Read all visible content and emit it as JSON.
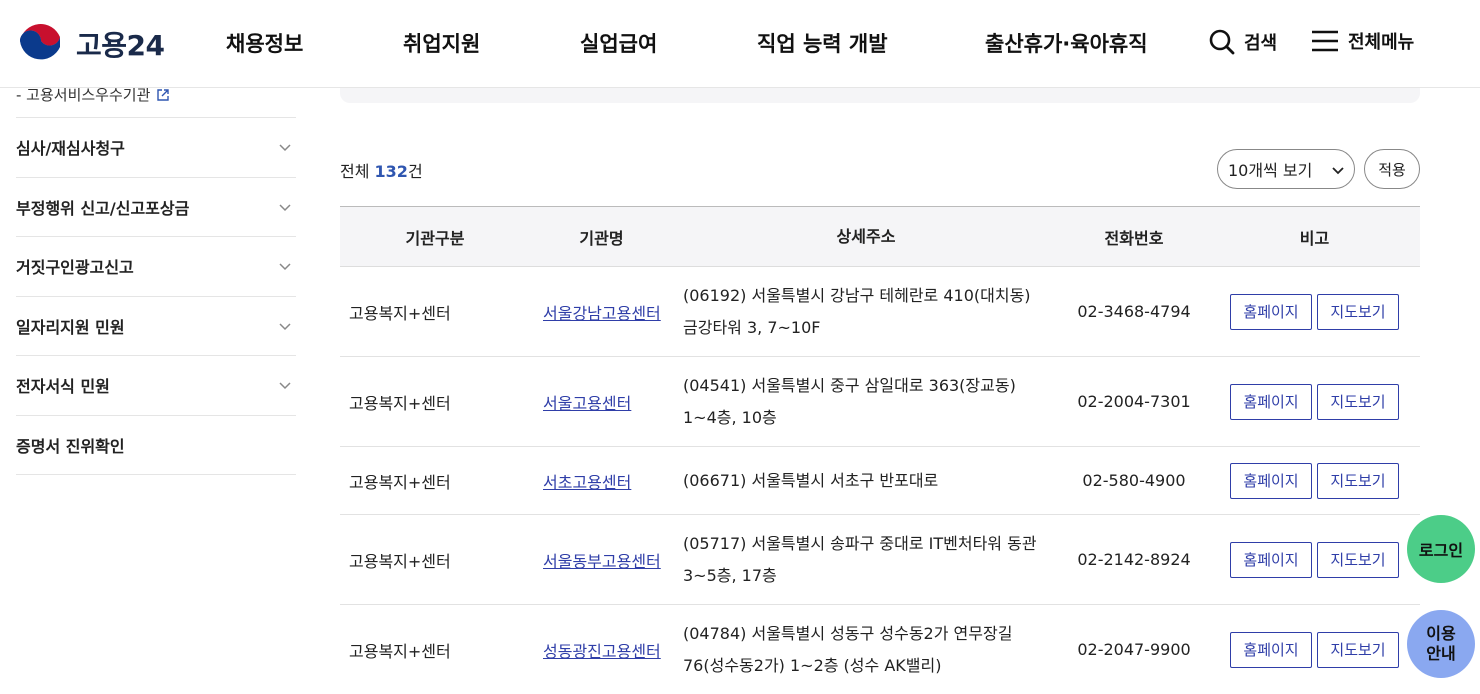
{
  "header": {
    "logo_text": "고용24",
    "nav": [
      "채용정보",
      "취업지원",
      "실업급여",
      "직업 능력 개발",
      "출산휴가·육아휴직"
    ],
    "search_label": "검색",
    "menu_label": "전체메뉴"
  },
  "sidebar": {
    "sub_item": "- 고용서비스우수기관",
    "items": [
      "심사/재심사청구",
      "부정행위 신고/신고포상금",
      "거짓구인광고신고",
      "일자리지원 민원",
      "전자서식 민원",
      "증명서 진위확인"
    ]
  },
  "main": {
    "total_prefix": "전체 ",
    "total_count": "132",
    "total_suffix": "건",
    "select_value": "10개씩 보기",
    "apply_label": "적용",
    "columns": [
      "기관구분",
      "기관명",
      "상세주소",
      "전화번호",
      "비고"
    ],
    "homepage_label": "홈페이지",
    "map_label": "지도보기",
    "rows": [
      {
        "type": "고용복지+센터",
        "name": "서울강남고용센터",
        "address": "(06192) 서울특별시 강남구 테헤란로 410(대치동) 금강타워 3, 7~10F",
        "phone": "02-3468-4794"
      },
      {
        "type": "고용복지+센터",
        "name": "서울고용센터",
        "address": "(04541) 서울특별시 중구 삼일대로 363(장교동) 1~4층, 10층",
        "phone": "02-2004-7301"
      },
      {
        "type": "고용복지+센터",
        "name": "서초고용센터",
        "address": "(06671) 서울특별시 서초구 반포대로",
        "phone": "02-580-4900"
      },
      {
        "type": "고용복지+센터",
        "name": "서울동부고용센터",
        "address": "(05717) 서울특별시 송파구 중대로 IT벤처타워 동관 3~5층, 17층",
        "phone": "02-2142-8924"
      },
      {
        "type": "고용복지+센터",
        "name": "성동광진고용센터",
        "address": "(04784) 서울특별시 성동구 성수동2가 연무장길 76(성수동2가) 1~2층 (성수 AK밸리)",
        "phone": "02-2047-9900"
      }
    ]
  },
  "floating": {
    "login": "로그인",
    "guide_line1": "이용",
    "guide_line2": "안내"
  }
}
